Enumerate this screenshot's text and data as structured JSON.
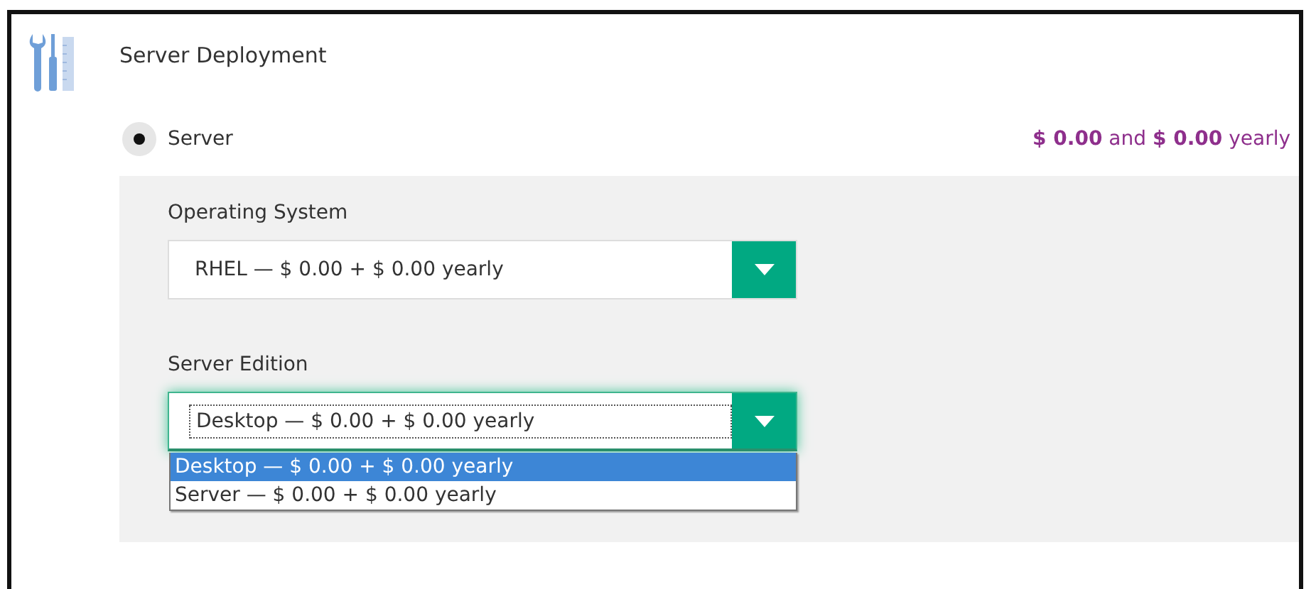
{
  "section": {
    "title": "Server Deployment"
  },
  "choice": {
    "label": "Server",
    "selected": true,
    "price": "**$ 0.00** and **$ 0.00** yearly"
  },
  "fields": [
    {
      "label": "Operating System",
      "value": "RHEL — $ 0.00 + $ 0.00 yearly",
      "focused": false
    },
    {
      "label": "Server Edition",
      "value": "Desktop — $ 0.00 + $ 0.00 yearly",
      "focused": true,
      "expanded": true,
      "options": [
        {
          "label": "Desktop — $ 0.00 + $ 0.00 yearly",
          "selected": true
        },
        {
          "label": "Server — $ 0.00 + $ 0.00 yearly",
          "selected": false
        }
      ]
    }
  ]
}
